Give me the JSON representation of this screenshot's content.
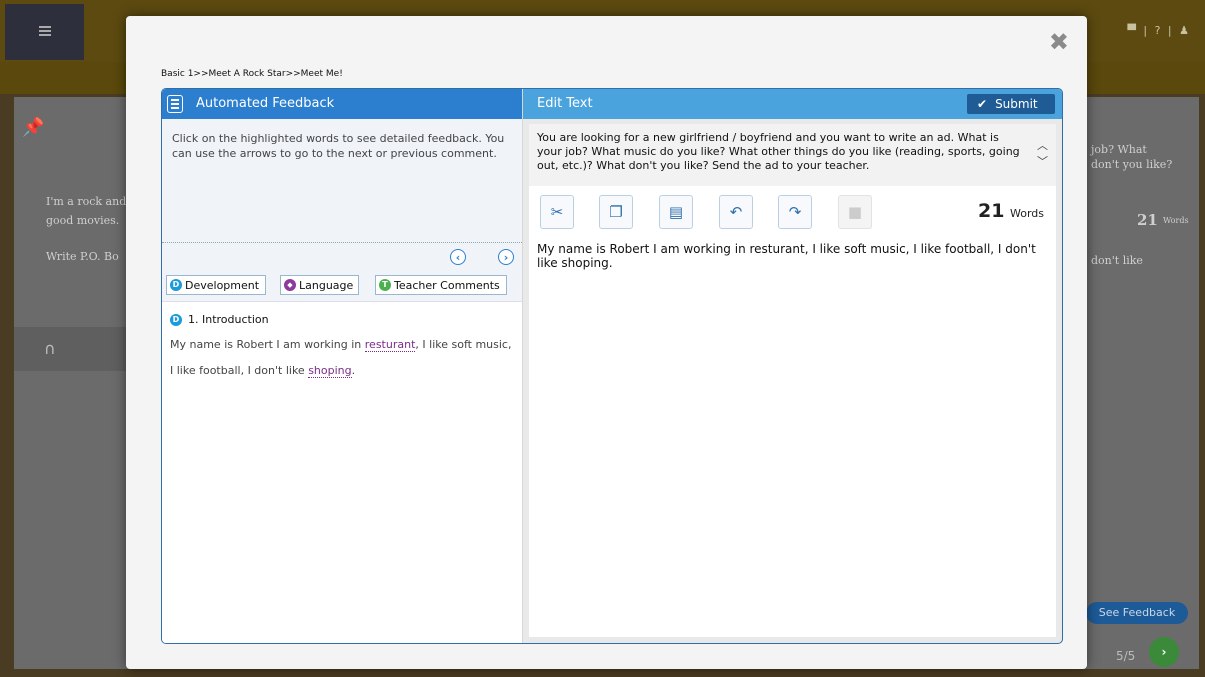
{
  "background": {
    "top_icons": "▀ | ? | ♟",
    "texts": {
      "line1": "I'm a rock and",
      "line2": "good movies.",
      "line3": "Write P.O. Bo",
      "right1": "job? What",
      "right2": "don't you like?",
      "right3": "don't like",
      "word_count_num": "21",
      "word_count_unit": "Words"
    },
    "see_feedback": "See Feedback",
    "pager": "5/5"
  },
  "modal": {
    "breadcrumb": "Basic 1>>Meet A Rock Star>>Meet Me!",
    "left_panel": {
      "title": "Automated Feedback",
      "instructions": "Click on the highlighted words to see detailed feedback. You can use the arrows to go to the next or previous comment.",
      "tabs": [
        {
          "label": "Development",
          "badge": "D",
          "color": "#1b9bd9"
        },
        {
          "label": "Language",
          "badge": "◆",
          "color": "#8c3a9c"
        },
        {
          "label": "Teacher Comments",
          "badge": "T",
          "color": "#4caf50"
        }
      ],
      "feedback": {
        "badge": "D",
        "heading": "1. Introduction",
        "text_before": "My name is Robert I am working in ",
        "highlight1": "resturant",
        "text_middle": ", I like soft music, I like football, I don't like ",
        "highlight2": "shoping",
        "text_after": "."
      }
    },
    "right_panel": {
      "title": "Edit Text",
      "submit_label": "Submit",
      "prompt": "You are looking for a new girlfriend / boyfriend and you want to write an ad. What is your job? What music do you like? What other things do you like (reading, sports, going out, etc.)? What don't you like? Send the ad to your teacher.",
      "word_count": "21",
      "word_count_unit": "Words",
      "essay": "My name is Robert I am working in resturant, I like soft music, I like football, I don't like shoping."
    }
  }
}
